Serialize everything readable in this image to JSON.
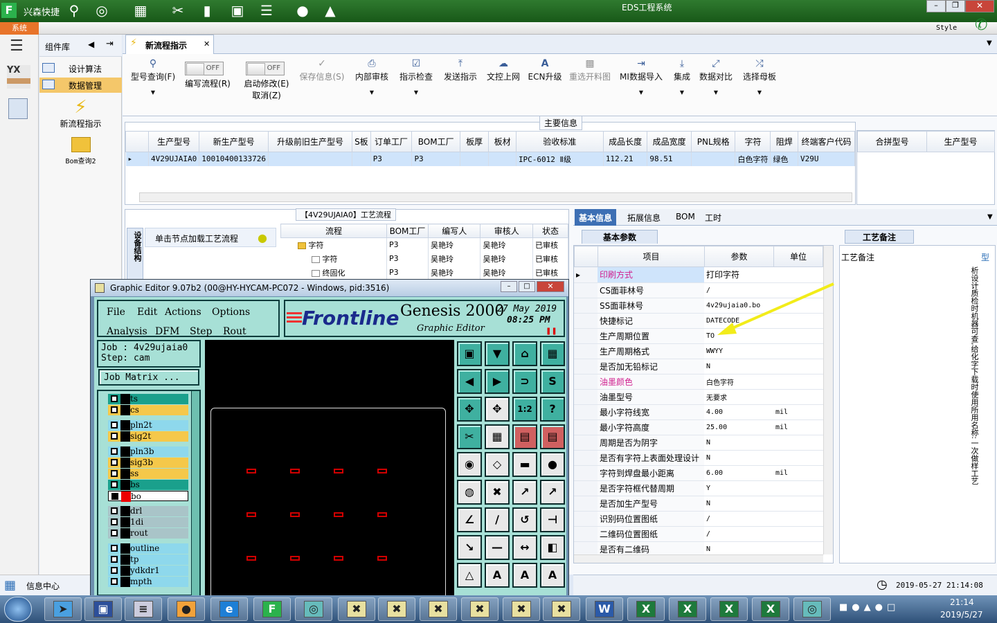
{
  "top": {
    "brand": "兴森快捷",
    "system_title": "EDS工程系统",
    "style_label": "Style"
  },
  "systab": {
    "label": "系统"
  },
  "leftnav": {
    "components_label": "组件库",
    "items": [
      {
        "label": "设计算法"
      },
      {
        "label": "数据管理"
      }
    ],
    "tools": [
      {
        "label": "新流程指示"
      },
      {
        "label": "Bom查询2"
      }
    ],
    "footer_label": "信息中心"
  },
  "tabs": [
    {
      "label": "新流程指示"
    }
  ],
  "ribbon": {
    "items": [
      {
        "label": "型号查询(F)",
        "icon": "search-icon",
        "disabled": false
      },
      {
        "label": "编写流程(R)",
        "toggle": "OFF"
      },
      {
        "label": "启动修改(E)",
        "sub": "取消(Z)",
        "toggle": "OFF"
      },
      {
        "label": "保存信息(S)",
        "icon": "check-icon",
        "disabled": true
      },
      {
        "label": "内部审核",
        "icon": "printer-icon",
        "disabled": false
      },
      {
        "label": "指示检查",
        "icon": "check-box-icon",
        "disabled": false
      },
      {
        "label": "发送指示",
        "icon": "upload-icon",
        "disabled": false
      },
      {
        "label": "文控上网",
        "icon": "cloud-upload-icon",
        "disabled": false
      },
      {
        "label": "ECN升级",
        "icon": "font-icon",
        "disabled": false
      },
      {
        "label": "重选开料图",
        "icon": "image-icon",
        "disabled": true
      },
      {
        "label": "MI数据导入",
        "icon": "import-icon",
        "disabled": false
      },
      {
        "label": "集成",
        "icon": "download-icon",
        "disabled": false
      },
      {
        "label": "数据对比",
        "icon": "compare-icon",
        "disabled": false
      },
      {
        "label": "选择母板",
        "icon": "shuffle-icon",
        "disabled": false
      }
    ]
  },
  "main_info": {
    "title": "主要信息",
    "columns": [
      "生产型号",
      "新生产型号",
      "升级前旧生产型号",
      "S板",
      "订单工厂",
      "BOM工厂",
      "板厚",
      "板材",
      "验收标准",
      "成品长度",
      "成品宽度",
      "PNL规格",
      "字符",
      "阻焊",
      "终端客户代码"
    ],
    "row": [
      "4V29UJAIA0",
      "10010400133726",
      "",
      "",
      "P3",
      "P3",
      "",
      "",
      "IPC-6012 Ⅱ级",
      "112.21",
      "98.51",
      "",
      "白色字符",
      "绿色",
      "V29U"
    ],
    "side_columns": [
      "合拼型号",
      "生产型号"
    ]
  },
  "flow": {
    "title": "【4V29UJAIA0】工艺流程",
    "vtab": "设备结构",
    "hint": "单击节点加载工艺流程",
    "columns": [
      "流程",
      "BOM工厂",
      "编写人",
      "审核人",
      "状态"
    ],
    "rows": [
      {
        "name": "字符",
        "factory": "P3",
        "writer": "吴艳玲",
        "reviewer": "吴艳玲",
        "status": "已审核",
        "folder": true
      },
      {
        "name": "字符",
        "factory": "P3",
        "writer": "吴艳玲",
        "reviewer": "吴艳玲",
        "status": "已审核",
        "folder": false
      },
      {
        "name": "终固化",
        "factory": "P3",
        "writer": "吴艳玲",
        "reviewer": "吴艳玲",
        "status": "已审核",
        "folder": false
      }
    ]
  },
  "right": {
    "tabs": [
      "基本信息",
      "拓展信息",
      "BOM",
      "工时"
    ],
    "subtab": "基本参数",
    "columns": [
      "项目",
      "参数",
      "单位"
    ],
    "remark_title": "工艺备注",
    "remark_col": "工艺备注",
    "remark_col2": "型",
    "remark_text": "析设计质检时机器可查,给化字下载时使用所用名称:一次做样工艺",
    "props": [
      {
        "item": "印刷方式",
        "value": "打印字符",
        "unit": "",
        "pink": true,
        "sel": true
      },
      {
        "item": "CS面菲林号",
        "value": "/",
        "unit": ""
      },
      {
        "item": "SS面菲林号",
        "value": "4v29ujaia0.bo",
        "unit": ""
      },
      {
        "item": "快捷标记",
        "value": "DATECODE",
        "unit": ""
      },
      {
        "item": "生产周期位置",
        "value": "TO",
        "unit": ""
      },
      {
        "item": "生产周期格式",
        "value": "WWYY",
        "unit": ""
      },
      {
        "item": "是否加无铅标记",
        "value": "N",
        "unit": ""
      },
      {
        "item": "油墨颜色",
        "value": "白色字符",
        "unit": "",
        "pink": true
      },
      {
        "item": "油墨型号",
        "value": "无要求",
        "unit": ""
      },
      {
        "item": "最小字符线宽",
        "value": "4.00",
        "unit": "mil"
      },
      {
        "item": "最小字符高度",
        "value": "25.00",
        "unit": "mil"
      },
      {
        "item": "周期是否为阴字",
        "value": "N",
        "unit": ""
      },
      {
        "item": "是否有字符上表面处理设计",
        "value": "N",
        "unit": ""
      },
      {
        "item": "字符到焊盘最小距离",
        "value": "6.00",
        "unit": "mil"
      },
      {
        "item": "是否字符框代替周期",
        "value": "Y",
        "unit": ""
      },
      {
        "item": "是否加生产型号",
        "value": "N",
        "unit": ""
      },
      {
        "item": "识别码位置图纸",
        "value": "/",
        "unit": ""
      },
      {
        "item": "二维码位置图纸",
        "value": "/",
        "unit": ""
      },
      {
        "item": "是否有二维码",
        "value": "N",
        "unit": ""
      }
    ]
  },
  "status": {
    "timestamp": "2019-05-27 21:14:08"
  },
  "genesis": {
    "title": "Graphic Editor 9.07b2 (00@HY-HYCAM-PC072 - Windows, pid:3516)",
    "menus": [
      "File",
      "Edit",
      "Actions",
      "Options",
      "Analysis",
      "DFM",
      "Step",
      "Rout"
    ],
    "brand": "Frontline",
    "product": "Genesis 2000",
    "subtitle": "Graphic Editor",
    "date": "27 May 2019",
    "time": "08:25 PM",
    "job": "Job : 4v29ujaia0",
    "step": "Step: cam",
    "matrix_button": "Job Matrix ...",
    "layers": [
      {
        "name": "ts",
        "color": "#1aa08c"
      },
      {
        "name": "cs",
        "color": "#f5c84a"
      },
      {
        "name": "pln2t",
        "color": "#8ed8ec"
      },
      {
        "name": "sig2t",
        "color": "#f5c84a"
      },
      {
        "name": "pln3b",
        "color": "#8ed8ec"
      },
      {
        "name": "sig3b",
        "color": "#f5c84a"
      },
      {
        "name": "ss",
        "color": "#f5c84a"
      },
      {
        "name": "bs",
        "color": "#1aa08c"
      },
      {
        "name": "bo",
        "color": "#ffffff"
      },
      {
        "name": "drl",
        "color": "#a9c4c8"
      },
      {
        "name": "1di",
        "color": "#a9c4c8"
      },
      {
        "name": "rout",
        "color": "#a9c4c8"
      },
      {
        "name": "outline",
        "color": "#8ed8ec"
      },
      {
        "name": "tp",
        "color": "#8ed8ec"
      },
      {
        "name": "ydkdr1",
        "color": "#8ed8ec"
      },
      {
        "name": "mpth",
        "color": "#8ed8ec"
      }
    ],
    "tool_labels": {
      "one_two": "1:2",
      "question": "?"
    }
  },
  "taskbar": {
    "time": "21:14",
    "date": "2019/5/27"
  }
}
